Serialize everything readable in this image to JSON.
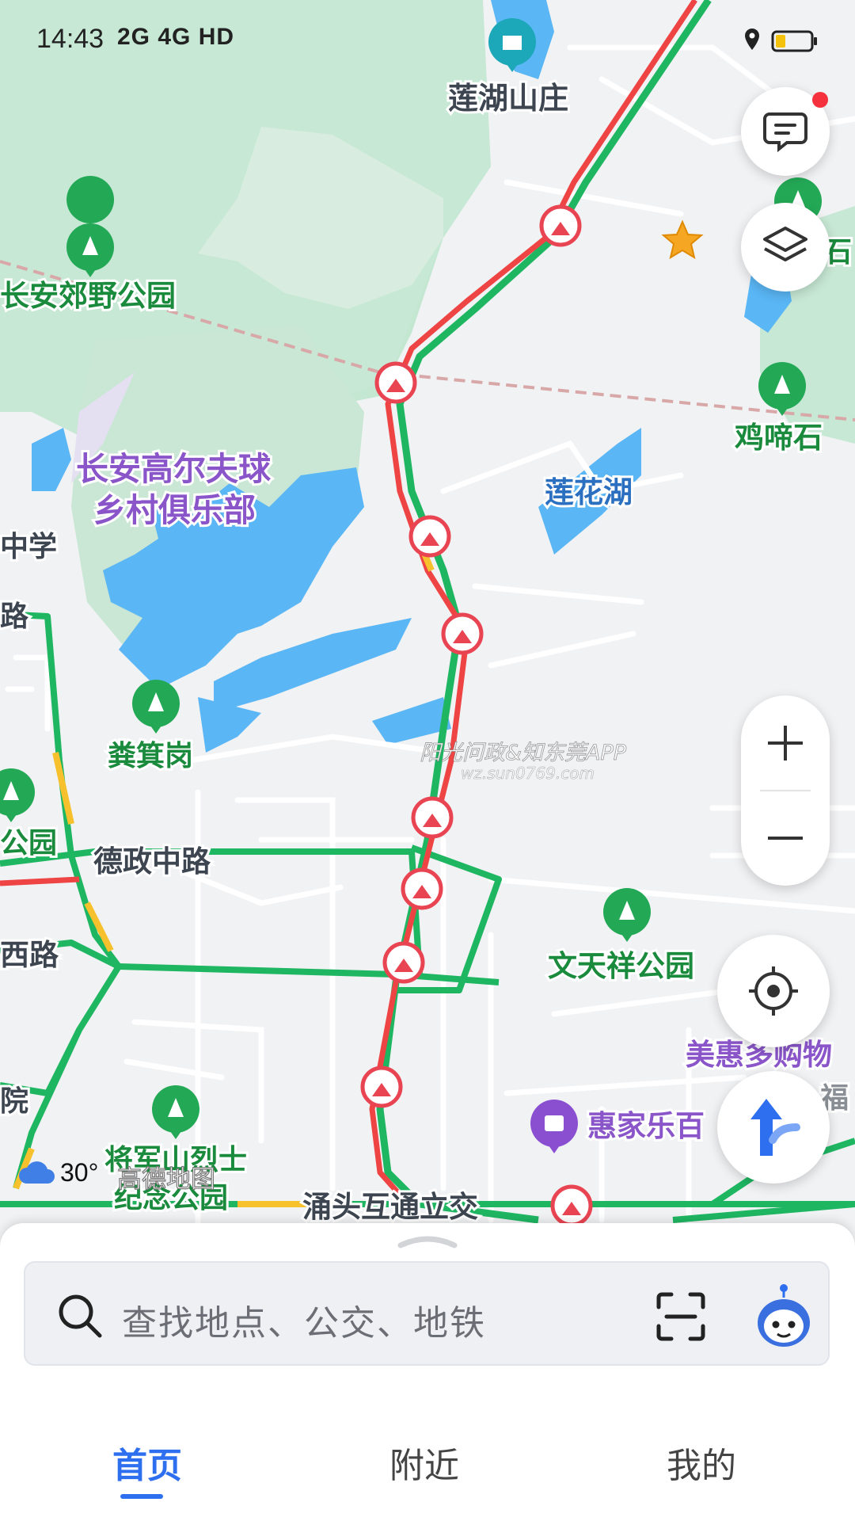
{
  "status_bar": {
    "time": "14:43",
    "network": "2G 4G HD"
  },
  "map": {
    "labels": {
      "lianhu_shanzhuang": "莲湖山庄",
      "changan_park": "长安郊野公园",
      "golf_club_line1": "长安高尔夫球",
      "golf_club_line2": "乡村俱乐部",
      "lianhua_lake": "莲花湖",
      "jitishi": "鸡啼石",
      "school": "中学",
      "lu": "路",
      "fenjigang": "粪箕岗",
      "dezheng_road": "德政中路",
      "park_left": "公园",
      "west_road": "西路",
      "wentianxiang_park": "文天祥公园",
      "meihui_mall": "美惠多购物",
      "fu": "福",
      "huijiale": "惠家乐百",
      "yuan": "院",
      "general_hill_line1": "将军山烈士",
      "general_hill_line2": "纪念公园",
      "yongtou_interchange": "涌头互通立交",
      "east_edge": "石"
    }
  },
  "weather": {
    "temperature": "30°"
  },
  "map_logo": "高德地图",
  "watermark": {
    "line1": "阳光问政&知东莞APP",
    "line2": "wz.sun0769.com"
  },
  "search": {
    "placeholder": "查找地点、公交、地铁"
  },
  "tabs": [
    {
      "label": "首页",
      "active": true
    },
    {
      "label": "附近",
      "active": false
    },
    {
      "label": "我的",
      "active": false
    }
  ],
  "colors": {
    "accent": "#2e6ff0",
    "road_clear": "#1fb662",
    "road_jam": "#ee4444",
    "road_slow": "#f6c12c",
    "water": "#5ab6f5",
    "green_area": "#bfe6cd",
    "park_label": "#1a8a3c",
    "poi_purple": "#7b4fc6"
  }
}
